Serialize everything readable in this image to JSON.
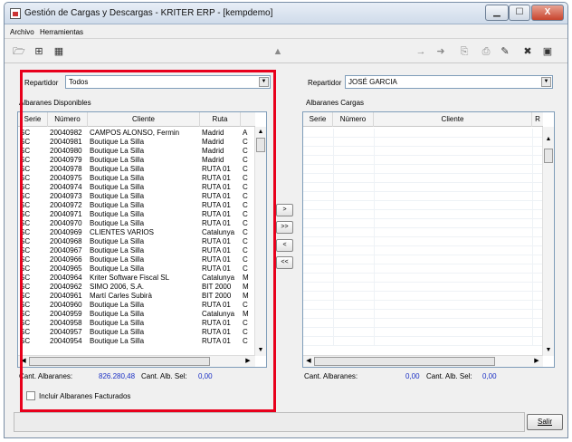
{
  "window": {
    "title": "Gestión de Cargas y Descargas - KRITER ERP -  [kempdemo]",
    "controls": [
      "▁",
      "☐",
      "X"
    ]
  },
  "menu": [
    "Archivo",
    "Herramientas"
  ],
  "toolbar": {
    "left": [
      {
        "icon": "open-folder-icon",
        "glyph": "🗁"
      },
      {
        "icon": "window-icon",
        "glyph": "⊞"
      },
      {
        "icon": "grid-icon",
        "glyph": "▦"
      }
    ],
    "center": {
      "icon": "delete-icon",
      "glyph": "▲"
    },
    "right": [
      {
        "icon": "arrow-right-icon",
        "glyph": "→"
      },
      {
        "icon": "arrow-icon",
        "glyph": "➜"
      },
      {
        "icon": "clipboard-icon",
        "glyph": "⎘"
      },
      {
        "icon": "print-icon",
        "glyph": "⎙"
      },
      {
        "icon": "edit-icon",
        "glyph": "✎"
      },
      {
        "icon": "cancel-icon",
        "glyph": "✖"
      },
      {
        "icon": "save-icon",
        "glyph": "▣"
      }
    ]
  },
  "left": {
    "repartidor_label": "Repartidor",
    "repartidor_value": "Todos",
    "section_title": "Albaranes Disponibles",
    "columns": [
      "Serie",
      "Número",
      "Cliente",
      "Ruta"
    ],
    "rows": [
      [
        "SC",
        "20040982",
        "CAMPOS ALONSO, Fermin",
        "Madrid",
        "A"
      ],
      [
        "SC",
        "20040981",
        "Boutique La Silla",
        "Madrid",
        "C"
      ],
      [
        "SC",
        "20040980",
        "Boutique La Silla",
        "Madrid",
        "C"
      ],
      [
        "SC",
        "20040979",
        "Boutique La Silla",
        "Madrid",
        "C"
      ],
      [
        "SC",
        "20040978",
        "Boutique La Silla",
        "RUTA 01",
        "C"
      ],
      [
        "SC",
        "20040975",
        "Boutique La Silla",
        "RUTA 01",
        "C"
      ],
      [
        "SC",
        "20040974",
        "Boutique La Silla",
        "RUTA 01",
        "C"
      ],
      [
        "SC",
        "20040973",
        "Boutique La Silla",
        "RUTA 01",
        "C"
      ],
      [
        "SC",
        "20040972",
        "Boutique La Silla",
        "RUTA 01",
        "C"
      ],
      [
        "SC",
        "20040971",
        "Boutique La Silla",
        "RUTA 01",
        "C"
      ],
      [
        "SC",
        "20040970",
        "Boutique La Silla",
        "RUTA 01",
        "C"
      ],
      [
        "SC",
        "20040969",
        "CLIENTES VARIOS",
        "Catalunya",
        "C"
      ],
      [
        "SC",
        "20040968",
        "Boutique La Silla",
        "RUTA 01",
        "C"
      ],
      [
        "SC",
        "20040967",
        "Boutique La Silla",
        "RUTA 01",
        "C"
      ],
      [
        "SC",
        "20040966",
        "Boutique La Silla",
        "RUTA 01",
        "C"
      ],
      [
        "SC",
        "20040965",
        "Boutique La Silla",
        "RUTA 01",
        "C"
      ],
      [
        "SC",
        "20040964",
        "Kriter Software Fiscal SL",
        "Catalunya",
        "M"
      ],
      [
        "SC",
        "20040962",
        "SIMO 2006, S.A.",
        "BIT 2000",
        "M"
      ],
      [
        "SC",
        "20040961",
        "Martí Carles Subirà",
        "BIT 2000",
        "M"
      ],
      [
        "SC",
        "20040960",
        "Boutique La Silla",
        "RUTA 01",
        "C"
      ],
      [
        "SC",
        "20040959",
        "Boutique La Silla",
        "Catalunya",
        "M"
      ],
      [
        "SC",
        "20040958",
        "Boutique La Silla",
        "RUTA 01",
        "C"
      ],
      [
        "SC",
        "20040957",
        "Boutique La Silla",
        "RUTA 01",
        "C"
      ],
      [
        "SC",
        "20040954",
        "Boutique La Silla",
        "RUTA 01",
        "C"
      ]
    ],
    "cant_albaranes_label": "Cant. Albaranes:",
    "cant_albaranes_value": "826.280,48",
    "cant_alb_sel_label": "Cant. Alb. Sel:",
    "cant_alb_sel_value": "0,00",
    "incluir_label": "Incluir Albaranes Facturados"
  },
  "transfer_buttons": [
    ">",
    ">>",
    "<",
    "<<"
  ],
  "right": {
    "repartidor_label": "Repartidor",
    "repartidor_value": "JOSÉ GARCIA",
    "section_title": "Albaranes Cargas",
    "columns": [
      "Serie",
      "Número",
      "Cliente",
      "R"
    ],
    "cant_albaranes_label": "Cant. Albaranes:",
    "cant_albaranes_value": "0,00",
    "cant_alb_sel_label": "Cant. Alb. Sel:",
    "cant_alb_sel_value": "0,00"
  },
  "salir_label": "Salir",
  "colors": {
    "highlight_border": "#e8001c",
    "value_blue": "#1a2fc4"
  }
}
